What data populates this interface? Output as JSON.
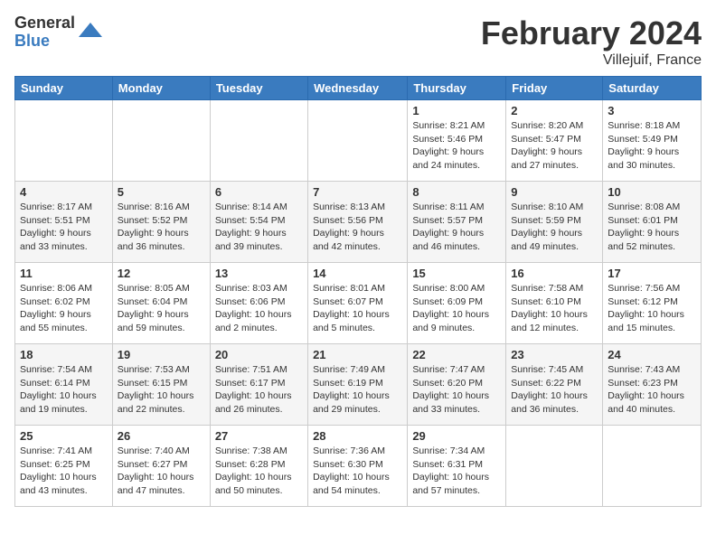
{
  "header": {
    "logo_general": "General",
    "logo_blue": "Blue",
    "month_title": "February 2024",
    "location": "Villejuif, France"
  },
  "weekdays": [
    "Sunday",
    "Monday",
    "Tuesday",
    "Wednesday",
    "Thursday",
    "Friday",
    "Saturday"
  ],
  "weeks": [
    [
      {
        "day": "",
        "content": ""
      },
      {
        "day": "",
        "content": ""
      },
      {
        "day": "",
        "content": ""
      },
      {
        "day": "",
        "content": ""
      },
      {
        "day": "1",
        "content": "Sunrise: 8:21 AM\nSunset: 5:46 PM\nDaylight: 9 hours\nand 24 minutes."
      },
      {
        "day": "2",
        "content": "Sunrise: 8:20 AM\nSunset: 5:47 PM\nDaylight: 9 hours\nand 27 minutes."
      },
      {
        "day": "3",
        "content": "Sunrise: 8:18 AM\nSunset: 5:49 PM\nDaylight: 9 hours\nand 30 minutes."
      }
    ],
    [
      {
        "day": "4",
        "content": "Sunrise: 8:17 AM\nSunset: 5:51 PM\nDaylight: 9 hours\nand 33 minutes."
      },
      {
        "day": "5",
        "content": "Sunrise: 8:16 AM\nSunset: 5:52 PM\nDaylight: 9 hours\nand 36 minutes."
      },
      {
        "day": "6",
        "content": "Sunrise: 8:14 AM\nSunset: 5:54 PM\nDaylight: 9 hours\nand 39 minutes."
      },
      {
        "day": "7",
        "content": "Sunrise: 8:13 AM\nSunset: 5:56 PM\nDaylight: 9 hours\nand 42 minutes."
      },
      {
        "day": "8",
        "content": "Sunrise: 8:11 AM\nSunset: 5:57 PM\nDaylight: 9 hours\nand 46 minutes."
      },
      {
        "day": "9",
        "content": "Sunrise: 8:10 AM\nSunset: 5:59 PM\nDaylight: 9 hours\nand 49 minutes."
      },
      {
        "day": "10",
        "content": "Sunrise: 8:08 AM\nSunset: 6:01 PM\nDaylight: 9 hours\nand 52 minutes."
      }
    ],
    [
      {
        "day": "11",
        "content": "Sunrise: 8:06 AM\nSunset: 6:02 PM\nDaylight: 9 hours\nand 55 minutes."
      },
      {
        "day": "12",
        "content": "Sunrise: 8:05 AM\nSunset: 6:04 PM\nDaylight: 9 hours\nand 59 minutes."
      },
      {
        "day": "13",
        "content": "Sunrise: 8:03 AM\nSunset: 6:06 PM\nDaylight: 10 hours\nand 2 minutes."
      },
      {
        "day": "14",
        "content": "Sunrise: 8:01 AM\nSunset: 6:07 PM\nDaylight: 10 hours\nand 5 minutes."
      },
      {
        "day": "15",
        "content": "Sunrise: 8:00 AM\nSunset: 6:09 PM\nDaylight: 10 hours\nand 9 minutes."
      },
      {
        "day": "16",
        "content": "Sunrise: 7:58 AM\nSunset: 6:10 PM\nDaylight: 10 hours\nand 12 minutes."
      },
      {
        "day": "17",
        "content": "Sunrise: 7:56 AM\nSunset: 6:12 PM\nDaylight: 10 hours\nand 15 minutes."
      }
    ],
    [
      {
        "day": "18",
        "content": "Sunrise: 7:54 AM\nSunset: 6:14 PM\nDaylight: 10 hours\nand 19 minutes."
      },
      {
        "day": "19",
        "content": "Sunrise: 7:53 AM\nSunset: 6:15 PM\nDaylight: 10 hours\nand 22 minutes."
      },
      {
        "day": "20",
        "content": "Sunrise: 7:51 AM\nSunset: 6:17 PM\nDaylight: 10 hours\nand 26 minutes."
      },
      {
        "day": "21",
        "content": "Sunrise: 7:49 AM\nSunset: 6:19 PM\nDaylight: 10 hours\nand 29 minutes."
      },
      {
        "day": "22",
        "content": "Sunrise: 7:47 AM\nSunset: 6:20 PM\nDaylight: 10 hours\nand 33 minutes."
      },
      {
        "day": "23",
        "content": "Sunrise: 7:45 AM\nSunset: 6:22 PM\nDaylight: 10 hours\nand 36 minutes."
      },
      {
        "day": "24",
        "content": "Sunrise: 7:43 AM\nSunset: 6:23 PM\nDaylight: 10 hours\nand 40 minutes."
      }
    ],
    [
      {
        "day": "25",
        "content": "Sunrise: 7:41 AM\nSunset: 6:25 PM\nDaylight: 10 hours\nand 43 minutes."
      },
      {
        "day": "26",
        "content": "Sunrise: 7:40 AM\nSunset: 6:27 PM\nDaylight: 10 hours\nand 47 minutes."
      },
      {
        "day": "27",
        "content": "Sunrise: 7:38 AM\nSunset: 6:28 PM\nDaylight: 10 hours\nand 50 minutes."
      },
      {
        "day": "28",
        "content": "Sunrise: 7:36 AM\nSunset: 6:30 PM\nDaylight: 10 hours\nand 54 minutes."
      },
      {
        "day": "29",
        "content": "Sunrise: 7:34 AM\nSunset: 6:31 PM\nDaylight: 10 hours\nand 57 minutes."
      },
      {
        "day": "",
        "content": ""
      },
      {
        "day": "",
        "content": ""
      }
    ]
  ]
}
